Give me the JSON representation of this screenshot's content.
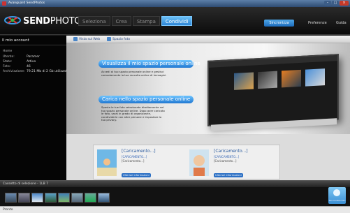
{
  "window": {
    "title": "Avanguard SendPhotos",
    "controls": [
      "–",
      "□",
      "×"
    ]
  },
  "header": {
    "logo_bold": "SEND",
    "logo_rest": "PHOTOS",
    "tabs": [
      {
        "label": "Seleziona",
        "active": false
      },
      {
        "label": "Crea",
        "active": false
      },
      {
        "label": "Stampa",
        "active": false
      },
      {
        "label": "Condividi",
        "active": true
      }
    ],
    "sync_label": "Sincronizza",
    "preferences": "Preferenze",
    "guide": "Guida"
  },
  "sidebar": {
    "title": "Il mio account",
    "home": "Home",
    "fields": [
      {
        "label": "Utente:",
        "value": "Paramer"
      },
      {
        "label": "Stato:",
        "value": "Attivo"
      },
      {
        "label": "Foto:",
        "value": "46"
      },
      {
        "label": "Archiviazione:",
        "value": "79.21 Mb di 2 Gb utilizzato"
      }
    ]
  },
  "toolbar": {
    "web_label": "Vista sul Web",
    "space_label": "Spazio foto"
  },
  "promo": {
    "heading1": "Visualizza il mio spazio personale online",
    "text1": "Accedi al tuo spazio personale online e gestisci comodamente la tua raccolta online di immagini.",
    "heading2": "Carica nello spazio personale online",
    "text2": "Sposta le tue foto selezionate direttamente nel tuo spazio personale online. Dopo aver caricato le foto, sarai in grado di organizzarle, condividerle con altre persone e impostare la tua privacy."
  },
  "cards": [
    {
      "title": "[Caricamento...]",
      "sub1": "[CARICAMENTO...]",
      "sub2": "[Caricamento...]",
      "button": "Ulteriori informazioni"
    },
    {
      "title": "[Caricamento...]",
      "sub1": "[CARICAMENTO...]",
      "sub2": "[Caricamento...]",
      "button": "Ulteriori informazioni"
    }
  ],
  "selection_bar": {
    "label": "Cassetto di selezione - 1LB 7"
  },
  "side_button": {
    "label": "Sincronizza foto"
  },
  "status": {
    "text": "Pronto"
  },
  "colors": {
    "accent": "#2f86d6",
    "header_bg": "#0b0b0b"
  }
}
